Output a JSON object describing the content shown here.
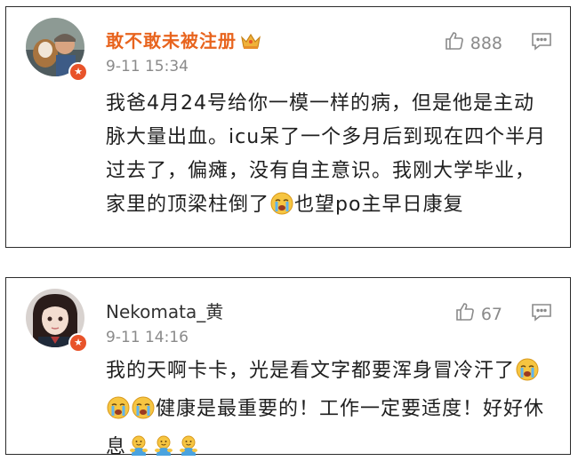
{
  "comments": [
    {
      "username": "敢不敢未被注册",
      "time": "9-11 15:34",
      "likes": "888",
      "text_a": "我爸4月24号给你一模一样的病，但是他是主动脉大量出血。icu呆了一个多月后到现在四个半月过去了，偏瘫，没有自主意识。我刚大学毕业，家里的顶梁柱倒了",
      "text_b": "也望po主早日康复",
      "name_color": "#e8641e",
      "icons": [
        "avatar",
        "verified-badge-icon",
        "crown-icon",
        "thumbs-up-icon",
        "comment-icon",
        "crying-emoji-icon"
      ]
    },
    {
      "username": "Nekomata_黄",
      "time": "9-11 14:16",
      "likes": "67",
      "text_a": "我的天啊卡卡，光是看文字都要浑身冒冷汗了",
      "text_b": "健康是最重要的！工作一定要适度！好好休息",
      "name_color": "#333333",
      "icons": [
        "avatar",
        "verified-badge-icon",
        "thumbs-up-icon",
        "comment-icon",
        "crying-emoji-icon",
        "hugging-emoji-icon"
      ]
    }
  ],
  "colors": {
    "border": "#2b2b2b",
    "muted": "#8a8a8a",
    "badge": "#e8532a"
  }
}
